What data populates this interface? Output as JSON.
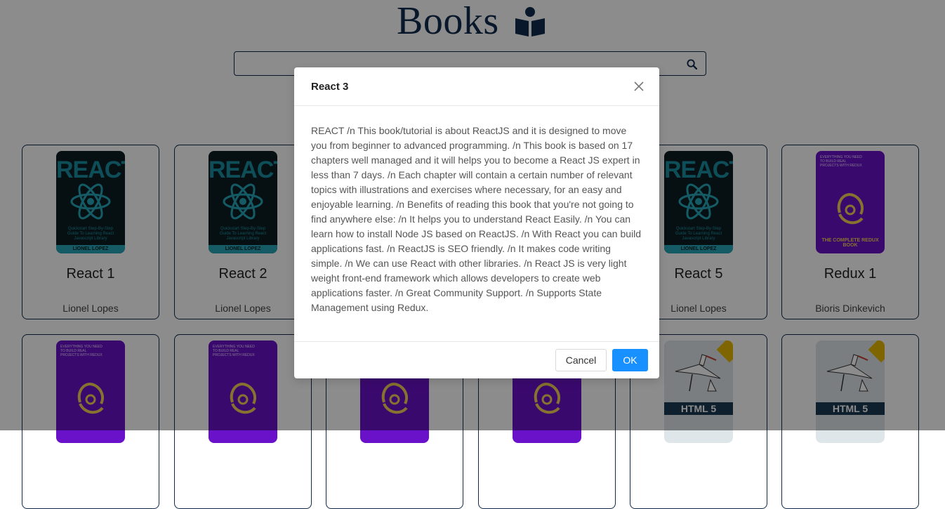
{
  "header": {
    "title": "Books",
    "title_icon": "book-reader-icon",
    "search": {
      "value": "",
      "placeholder": "",
      "icon": "search-icon"
    }
  },
  "books": [
    {
      "name": "React 1",
      "author": "Lionel Lopes",
      "cover": "react"
    },
    {
      "name": "React 2",
      "author": "Lionel Lopes",
      "cover": "react"
    },
    {
      "name": "React 5",
      "author": "Lionel Lopes",
      "cover": "react"
    },
    {
      "name": "Redux 1",
      "author": "Bioris Dinkevich",
      "cover": "redux"
    }
  ],
  "covers": {
    "react": {
      "title": "REACT",
      "subtitle": "Quickstart Step-By-Step Guide To Learning React Javascript Library",
      "author_band": "LIONEL LOPEZ"
    },
    "redux": {
      "top": "EVERYTHING YOU NEED TO BUILD REAL PROJECTS WITH REDUX",
      "label": "THE COMPLETE REDUX BOOK"
    },
    "html": {
      "label": "HTML 5"
    }
  },
  "modal": {
    "title": "React 3",
    "body": "REACT /n This book/tutorial is about ReactJS and it is designed to move you from beginner to advanced programming. /n This book is based on 17 chapters well managed and it will helps you to become a React JS expert in less than 7 days. /n Each chapter will contain a certain number of relevant topics with illustrations and exercises where necessary, for an easy and enjoyable learning. /n Benefits of reading this book that you're not going to find anywhere else: /n It helps you to understand React Easily. /n You can learn how to install Node JS based on ReactJS. /n With React you can build applications fast. /n ReactJS is SEO friendly. /n It makes code writing simple. /n We can use React with other libraries. /n React JS is very light weight front-end framework which allows developers to create web applications faster. /n Great Community Support. /n Supports State Management using Redux.",
    "cancel_label": "Cancel",
    "ok_label": "OK",
    "close_icon": "close-icon"
  },
  "colors": {
    "navy": "#0f2a4c",
    "primary": "#1890ff",
    "overlay": "rgba(0,0,0,0.45)",
    "react_cyan": "#27a6b9",
    "redux_purple": "#6a12c9"
  }
}
